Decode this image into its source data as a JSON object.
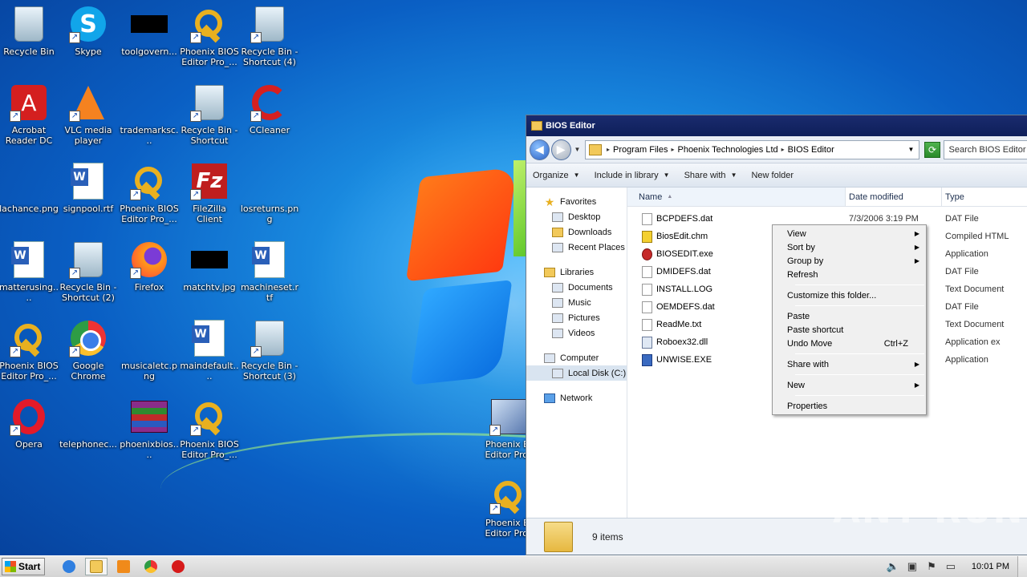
{
  "desktop_icons": [
    {
      "label": "Recycle Bin",
      "icon": "recycle-bin-icon"
    },
    {
      "label": "Skype",
      "icon": "skype-icon"
    },
    {
      "label": "toolgovern...",
      "icon": "black-thumbnail-icon"
    },
    {
      "label": "Phoenix BIOS Editor Pro_...",
      "icon": "key-icon"
    },
    {
      "label": "Recycle Bin - Shortcut (4)",
      "icon": "recycle-bin-icon"
    },
    {
      "label": "Acrobat Reader DC",
      "icon": "acrobat-icon"
    },
    {
      "label": "VLC media player",
      "icon": "vlc-icon"
    },
    {
      "label": "trademarksc...",
      "icon": "blank-image-icon"
    },
    {
      "label": "Recycle Bin - Shortcut",
      "icon": "recycle-bin-icon"
    },
    {
      "label": "CCleaner",
      "icon": "ccleaner-icon"
    },
    {
      "label": "lachance.png",
      "icon": "blank-image-icon"
    },
    {
      "label": "signpool.rtf",
      "icon": "word-document-icon"
    },
    {
      "label": "Phoenix BIOS Editor Pro_...",
      "icon": "key-icon"
    },
    {
      "label": "FileZilla Client",
      "icon": "filezilla-icon"
    },
    {
      "label": "losreturns.png",
      "icon": "blank-image-icon"
    },
    {
      "label": "matterusing....",
      "icon": "word-document-icon"
    },
    {
      "label": "Recycle Bin - Shortcut (2)",
      "icon": "recycle-bin-icon"
    },
    {
      "label": "Firefox",
      "icon": "firefox-icon"
    },
    {
      "label": "matchtv.jpg",
      "icon": "black-thumbnail-icon"
    },
    {
      "label": "machineset.rtf",
      "icon": "word-document-icon"
    },
    {
      "label": "Phoenix BIOS Editor Pro_...",
      "icon": "key-icon"
    },
    {
      "label": "Google Chrome",
      "icon": "chrome-icon"
    },
    {
      "label": "musicaletc.png",
      "icon": "blank-image-icon"
    },
    {
      "label": "maindefault....",
      "icon": "word-document-icon"
    },
    {
      "label": "Recycle Bin - Shortcut (3)",
      "icon": "recycle-bin-icon"
    },
    {
      "label": "Opera",
      "icon": "opera-icon"
    },
    {
      "label": "telephonec...",
      "icon": "blank-image-icon"
    },
    {
      "label": "phoenixbios....",
      "icon": "winrar-icon"
    },
    {
      "label": "Phoenix BIOS Editor Pro_...",
      "icon": "key-icon"
    },
    {
      "label": "Phoenix BI Editor Pro_",
      "icon": "setup-icon"
    },
    {
      "label": "Phoenix BI Editor Pro_",
      "icon": "key-icon"
    }
  ],
  "window": {
    "title": "BIOS Editor",
    "breadcrumb": [
      "Program Files",
      "Phoenix Technologies Ltd",
      "BIOS Editor"
    ],
    "search_placeholder": "Search BIOS Editor",
    "commands": [
      {
        "label": "Organize",
        "dropdown": true
      },
      {
        "label": "Include in library",
        "dropdown": true
      },
      {
        "label": "Share with",
        "dropdown": true
      },
      {
        "label": "New folder",
        "dropdown": false
      }
    ],
    "nav": {
      "favorites": "Favorites",
      "desktop": "Desktop",
      "downloads": "Downloads",
      "recent": "Recent Places",
      "libraries": "Libraries",
      "documents": "Documents",
      "music": "Music",
      "pictures": "Pictures",
      "videos": "Videos",
      "computer": "Computer",
      "local_disk": "Local Disk (C:)",
      "network": "Network"
    },
    "columns": {
      "name": "Name",
      "date": "Date modified",
      "type": "Type"
    },
    "files": [
      {
        "name": "BCPDEFS.dat",
        "date": "7/3/2006 3:19 PM",
        "type": "DAT File",
        "icon": "file-icon"
      },
      {
        "name": "BiosEdit.chm",
        "date": ":51 PM",
        "type": "Compiled HTML",
        "icon": "help-file-icon"
      },
      {
        "name": "BIOSEDIT.exe",
        "date": ":12 PM",
        "type": "Application",
        "icon": "exe-icon"
      },
      {
        "name": "DMIDEFS.dat",
        "date": ":08 PM",
        "type": "DAT File",
        "icon": "file-icon"
      },
      {
        "name": "INSTALL.LOG",
        "date": ":58 PM",
        "type": "Text Document",
        "icon": "file-icon"
      },
      {
        "name": "OEMDEFS.dat",
        "date": "2:52 PM",
        "type": "DAT File",
        "icon": "file-icon"
      },
      {
        "name": "ReadMe.txt",
        "date": ":55 PM",
        "type": "Text Document",
        "icon": "file-icon"
      },
      {
        "name": "Roboex32.dll",
        "date": "3:44 PM",
        "type": "Application ex",
        "icon": "dll-icon"
      },
      {
        "name": "UNWISE.EXE",
        "date": "0:55 AM",
        "type": "Application",
        "icon": "setup-icon"
      }
    ],
    "status": "9 items"
  },
  "context_menu": {
    "view": "View",
    "sort_by": "Sort by",
    "group_by": "Group by",
    "refresh": "Refresh",
    "customize": "Customize this folder...",
    "paste": "Paste",
    "paste_shortcut": "Paste shortcut",
    "undo_move": "Undo Move",
    "undo_shortcut": "Ctrl+Z",
    "share_with": "Share with",
    "new": "New",
    "properties": "Properties"
  },
  "watermark": "ANY RUN",
  "taskbar": {
    "start_label": "Start",
    "clock": "10:01 PM"
  }
}
